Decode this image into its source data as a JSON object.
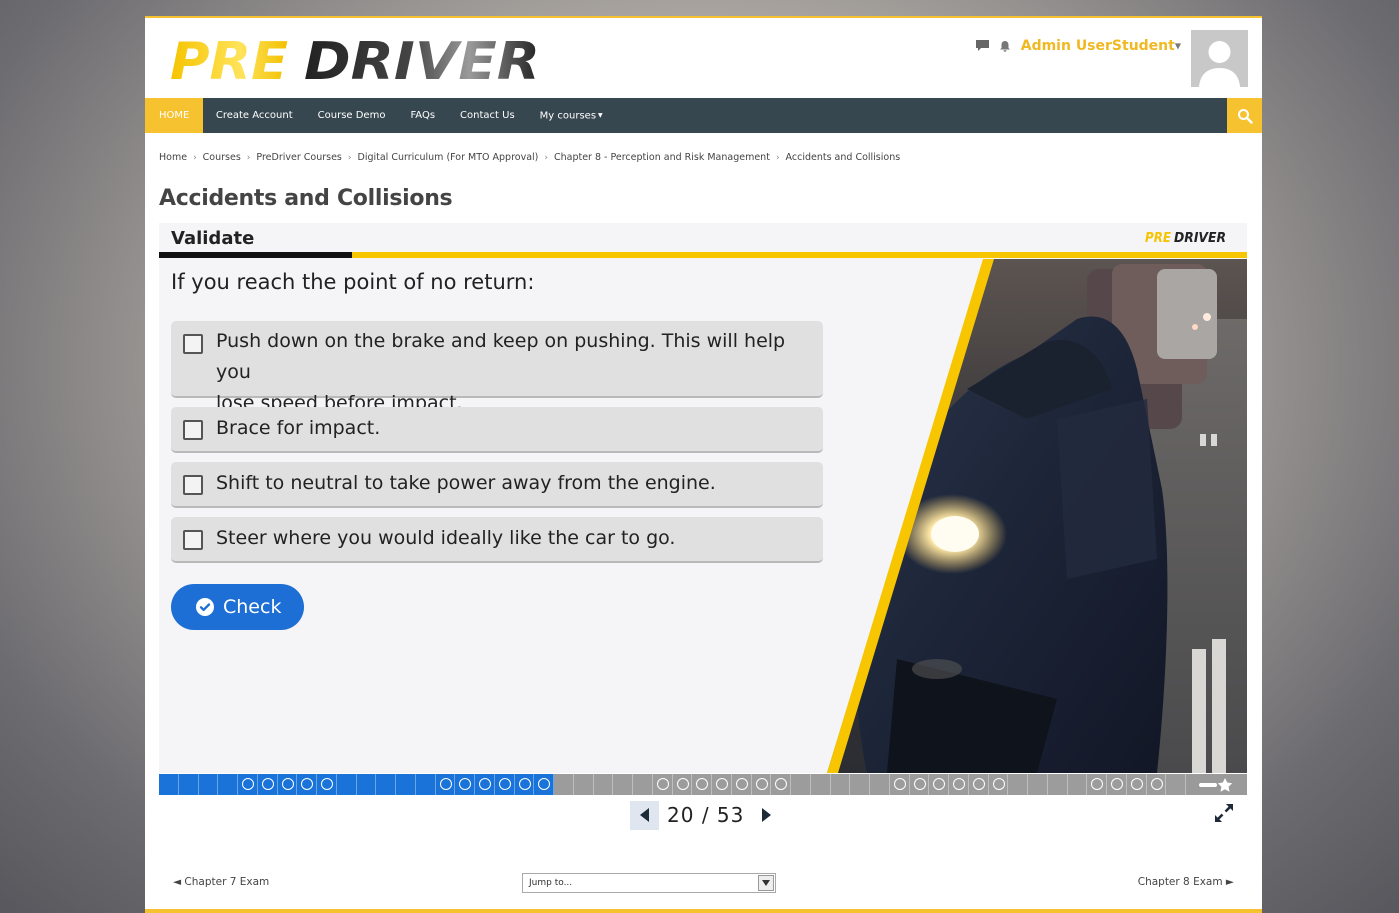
{
  "header": {
    "logo_text_pre": "PRE",
    "logo_text_driver": "DRIVER",
    "user_name": "Admin UserStudent"
  },
  "nav": {
    "items": [
      "HOME",
      "Create Account",
      "Course Demo",
      "FAQs",
      "Contact Us",
      "My courses"
    ]
  },
  "breadcrumb": [
    "Home",
    "Courses",
    "PreDriver Courses",
    "Digital Curriculum (For MTO Approval)",
    "Chapter 8 - Perception and Risk Management",
    "Accidents and Collisions"
  ],
  "page_title": "Accidents and Collisions",
  "slide": {
    "header_title": "Validate",
    "logo_pre": "PRE",
    "logo_driver": "DRIVER",
    "question": "If you reach the point of no return:",
    "options": [
      {
        "text_line1": "Push down on the brake and keep on pushing. This will help you",
        "text_line2": "lose speed before impact.",
        "checked": false
      },
      {
        "text_line1": "Brace for impact.",
        "checked": false
      },
      {
        "text_line1": "Shift to neutral to take power away from the engine.",
        "checked": false
      },
      {
        "text_line1": "Steer where you would ideally like the car to go.",
        "checked": false
      }
    ],
    "check_label": "Check"
  },
  "progress": {
    "completed": 20,
    "total": 53
  },
  "pager": {
    "current": "20",
    "separator": "/",
    "total": "53"
  },
  "footer_nav": {
    "prev_label": "◄ Chapter 7 Exam",
    "jump_placeholder": "Jump to...",
    "next_label": "Chapter 8 Exam ►"
  },
  "colors": {
    "accent_yellow": "#f7c230",
    "nav_bg": "#37474f",
    "button_blue": "#1d6fd6",
    "progress_done": "#1a73d9"
  }
}
